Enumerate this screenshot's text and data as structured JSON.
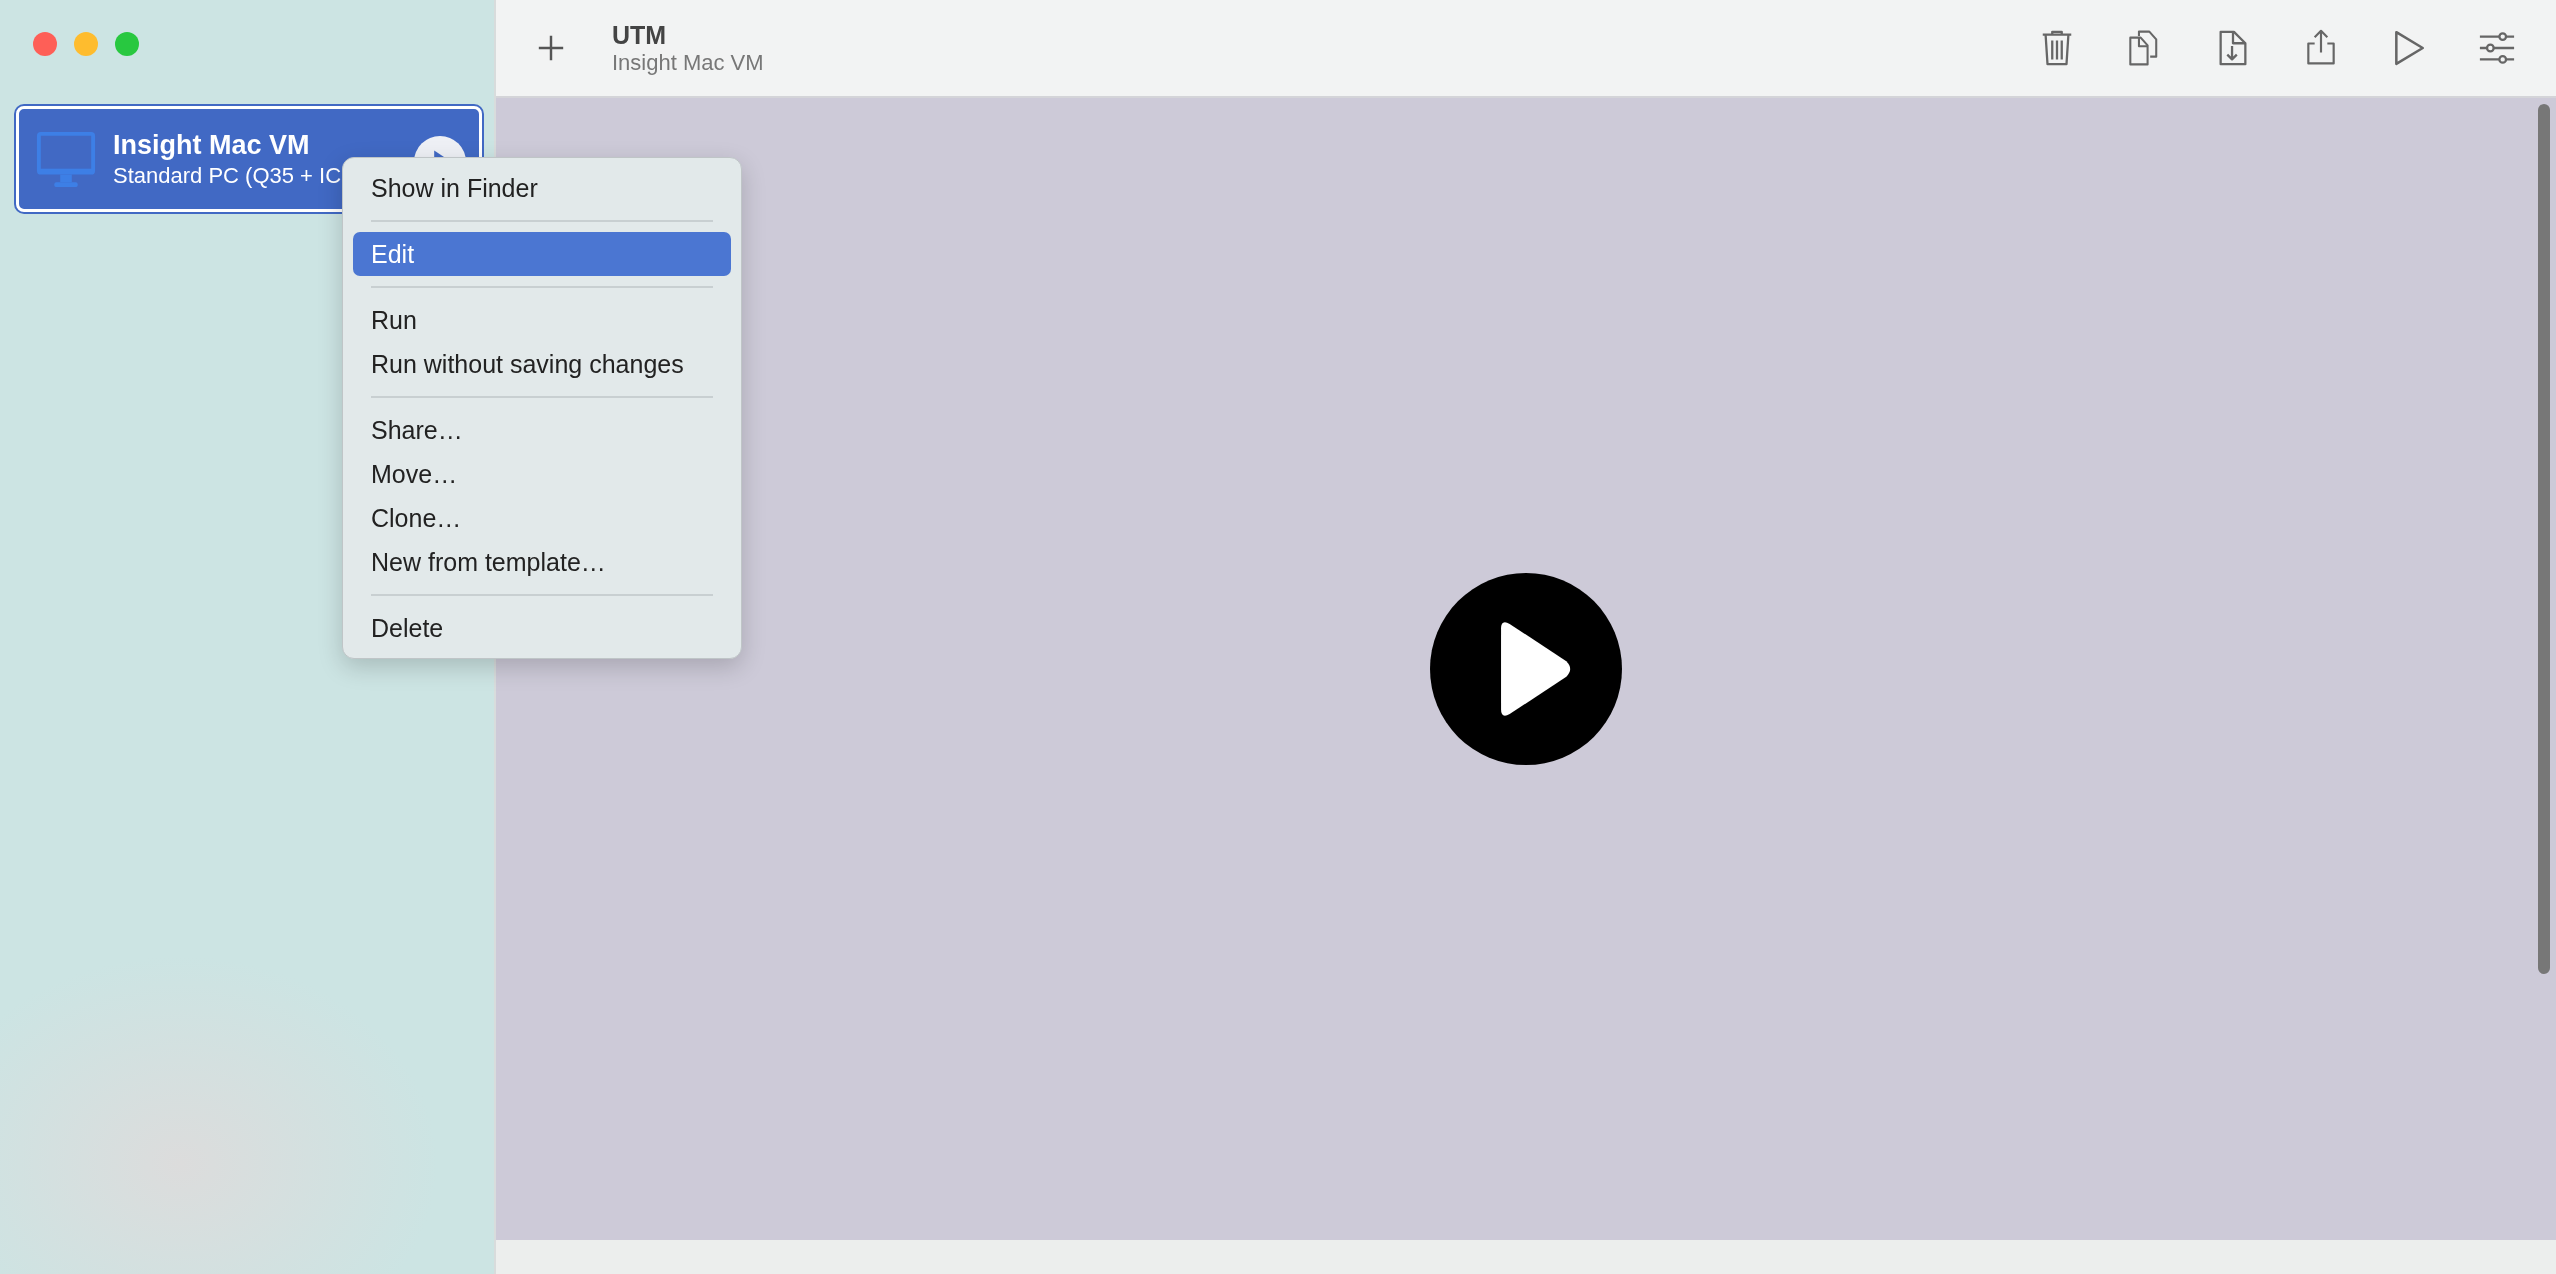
{
  "sidebar": {
    "items": [
      {
        "title": "Insight Mac VM",
        "subtitle": "Standard PC (Q35 + IC",
        "selected": true
      }
    ]
  },
  "toolbar": {
    "title": "UTM",
    "subtitle": "Insight Mac VM"
  },
  "context_menu": {
    "sections": [
      [
        {
          "label": "Show in Finder",
          "selected": false
        }
      ],
      [
        {
          "label": "Edit",
          "selected": true
        }
      ],
      [
        {
          "label": "Run",
          "selected": false
        },
        {
          "label": "Run without saving changes",
          "selected": false
        }
      ],
      [
        {
          "label": "Share…",
          "selected": false
        },
        {
          "label": "Move…",
          "selected": false
        },
        {
          "label": "Clone…",
          "selected": false
        },
        {
          "label": "New from template…",
          "selected": false
        }
      ],
      [
        {
          "label": "Delete",
          "selected": false
        }
      ]
    ]
  }
}
